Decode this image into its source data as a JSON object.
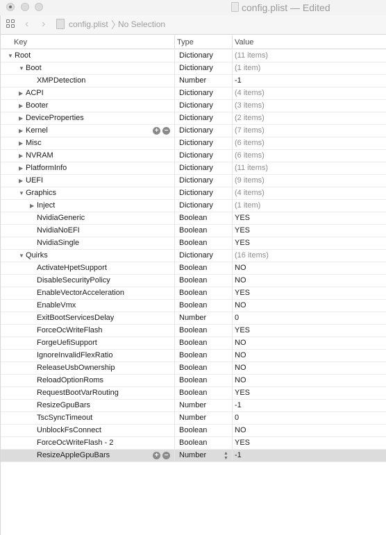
{
  "window": {
    "title": "config.plist — Edited"
  },
  "toolbar": {
    "file_name": "config.plist",
    "selection": "No Selection"
  },
  "columns": {
    "key": "Key",
    "type": "Type",
    "value": "Value"
  },
  "rows": [
    {
      "key": "Root",
      "type": "Dictionary",
      "value": "(11 items)",
      "level": 0,
      "disclosure": "expanded"
    },
    {
      "key": "Boot",
      "type": "Dictionary",
      "value": "(1 item)",
      "level": 1,
      "disclosure": "expanded"
    },
    {
      "key": "XMPDetection",
      "type": "Number",
      "value": "-1",
      "level": 2,
      "disclosure": "none"
    },
    {
      "key": "ACPI",
      "type": "Dictionary",
      "value": "(4 items)",
      "level": 1,
      "disclosure": "collapsed"
    },
    {
      "key": "Booter",
      "type": "Dictionary",
      "value": "(3 items)",
      "level": 1,
      "disclosure": "collapsed"
    },
    {
      "key": "DeviceProperties",
      "type": "Dictionary",
      "value": "(2 items)",
      "level": 1,
      "disclosure": "collapsed"
    },
    {
      "key": "Kernel",
      "type": "Dictionary",
      "value": "(7 items)",
      "level": 1,
      "disclosure": "collapsed",
      "row_buttons": true
    },
    {
      "key": "Misc",
      "type": "Dictionary",
      "value": "(6 items)",
      "level": 1,
      "disclosure": "collapsed"
    },
    {
      "key": "NVRAM",
      "type": "Dictionary",
      "value": "(6 items)",
      "level": 1,
      "disclosure": "collapsed"
    },
    {
      "key": "PlatformInfo",
      "type": "Dictionary",
      "value": "(11 items)",
      "level": 1,
      "disclosure": "collapsed"
    },
    {
      "key": "UEFI",
      "type": "Dictionary",
      "value": "(9 items)",
      "level": 1,
      "disclosure": "collapsed"
    },
    {
      "key": "Graphics",
      "type": "Dictionary",
      "value": "(4 items)",
      "level": 1,
      "disclosure": "expanded"
    },
    {
      "key": "Inject",
      "type": "Dictionary",
      "value": "(1 item)",
      "level": 2,
      "disclosure": "collapsed"
    },
    {
      "key": "NvidiaGeneric",
      "type": "Boolean",
      "value": "YES",
      "level": 2,
      "disclosure": "none"
    },
    {
      "key": "NvidiaNoEFI",
      "type": "Boolean",
      "value": "YES",
      "level": 2,
      "disclosure": "none"
    },
    {
      "key": "NvidiaSingle",
      "type": "Boolean",
      "value": "YES",
      "level": 2,
      "disclosure": "none"
    },
    {
      "key": "Quirks",
      "type": "Dictionary",
      "value": "(16 items)",
      "level": 1,
      "disclosure": "expanded"
    },
    {
      "key": "ActivateHpetSupport",
      "type": "Boolean",
      "value": "NO",
      "level": 2,
      "disclosure": "none"
    },
    {
      "key": "DisableSecurityPolicy",
      "type": "Boolean",
      "value": "NO",
      "level": 2,
      "disclosure": "none"
    },
    {
      "key": "EnableVectorAcceleration",
      "type": "Boolean",
      "value": "YES",
      "level": 2,
      "disclosure": "none"
    },
    {
      "key": "EnableVmx",
      "type": "Boolean",
      "value": "NO",
      "level": 2,
      "disclosure": "none"
    },
    {
      "key": "ExitBootServicesDelay",
      "type": "Number",
      "value": "0",
      "level": 2,
      "disclosure": "none"
    },
    {
      "key": "ForceOcWriteFlash",
      "type": "Boolean",
      "value": "YES",
      "level": 2,
      "disclosure": "none"
    },
    {
      "key": "ForgeUefiSupport",
      "type": "Boolean",
      "value": "NO",
      "level": 2,
      "disclosure": "none"
    },
    {
      "key": "IgnoreInvalidFlexRatio",
      "type": "Boolean",
      "value": "NO",
      "level": 2,
      "disclosure": "none"
    },
    {
      "key": "ReleaseUsbOwnership",
      "type": "Boolean",
      "value": "NO",
      "level": 2,
      "disclosure": "none"
    },
    {
      "key": "ReloadOptionRoms",
      "type": "Boolean",
      "value": "NO",
      "level": 2,
      "disclosure": "none"
    },
    {
      "key": "RequestBootVarRouting",
      "type": "Boolean",
      "value": "YES",
      "level": 2,
      "disclosure": "none"
    },
    {
      "key": "ResizeGpuBars",
      "type": "Number",
      "value": "-1",
      "level": 2,
      "disclosure": "none"
    },
    {
      "key": "TscSyncTimeout",
      "type": "Number",
      "value": "0",
      "level": 2,
      "disclosure": "none"
    },
    {
      "key": "UnblockFsConnect",
      "type": "Boolean",
      "value": "NO",
      "level": 2,
      "disclosure": "none"
    },
    {
      "key": "ForceOcWriteFlash - 2",
      "type": "Boolean",
      "value": "YES",
      "level": 2,
      "disclosure": "none"
    },
    {
      "key": "ResizeAppleGpuBars",
      "type": "Number",
      "value": "-1",
      "level": 2,
      "disclosure": "none",
      "row_buttons": true,
      "selected": true,
      "stepper": true
    }
  ]
}
